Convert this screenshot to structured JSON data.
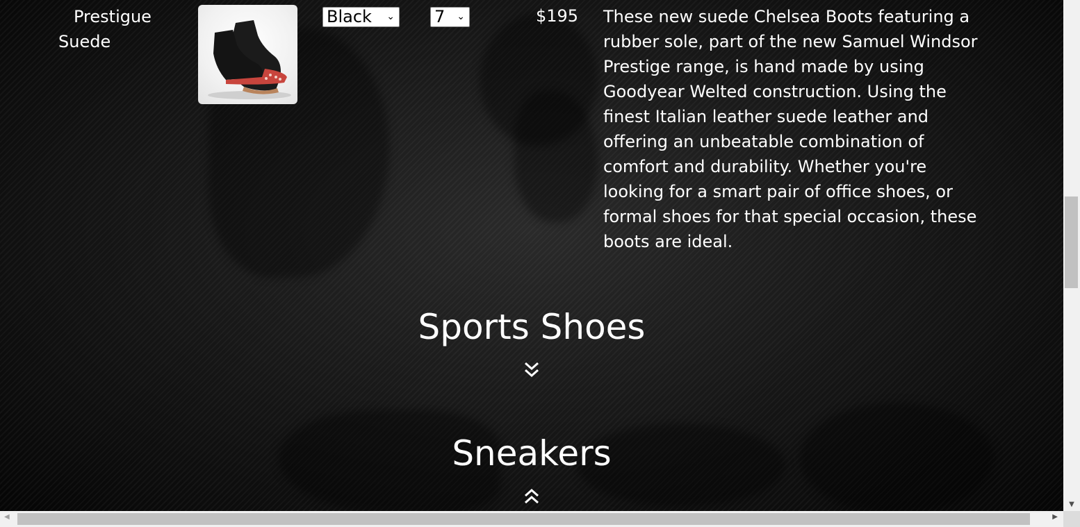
{
  "product": {
    "name_line1": "Prestigue",
    "name_line2": "Suede",
    "image_alt": "Black suede Chelsea boot with red sole",
    "color_select": "Black",
    "size_select": "7",
    "price": "$195",
    "description": "These new suede Chelsea Boots featuring a rubber sole, part of the new Samuel Windsor Prestige range, is hand made by using Goodyear Welted construction. Using the finest Italian leather suede leather and offering an unbeatable combination of comfort and durability. Whether you're looking for a smart pair of office shoes, or formal shoes for that special occasion, these boots are ideal."
  },
  "sections": {
    "sports_title": "Sports Shoes",
    "sports_toggle_icon": "double-chevron-down-icon",
    "sneakers_title": "Sneakers",
    "sneakers_toggle_icon": "double-chevron-up-icon"
  },
  "colors": {
    "background": "#0b0b0b",
    "text": "#ffffff",
    "scrollbar_track": "#f1f1f1",
    "scrollbar_thumb": "#c1c1c1"
  }
}
